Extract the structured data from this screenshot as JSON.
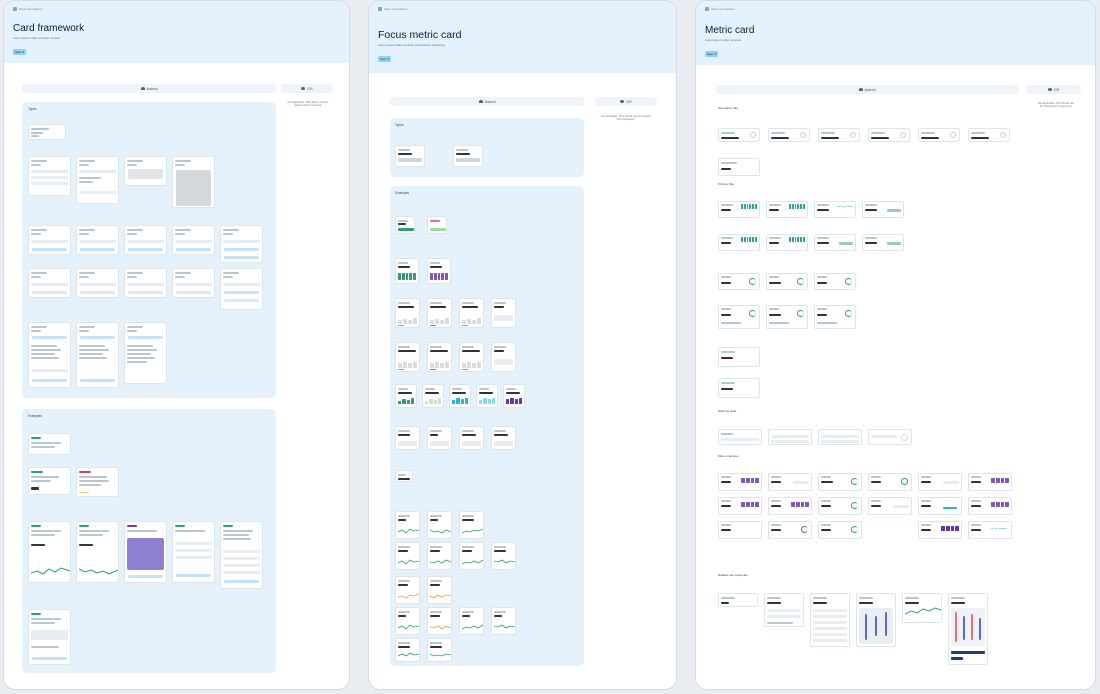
{
  "pages": [
    {
      "breadcrumb": "Wear Annotations",
      "title": "Card framework",
      "subtitle": "Lorem ipsum dolor sit amet consect",
      "spec_chip": "Spec ▾",
      "tabs": {
        "android": "Android",
        "ios": "iOS"
      },
      "note": "Not applicable. This doesn't use the nearest iOS component.",
      "sections": {
        "types": "Types",
        "examples": "Examples"
      }
    },
    {
      "breadcrumb": "Wear Annotations",
      "title": "Focus metric card",
      "subtitle": "Lorem ipsum dolor sit amet consectetur adipiscing",
      "spec_chip": "Spec ▾",
      "tabs": {
        "android": "Android",
        "ios": "iOS"
      },
      "note": "Not applicable. This should use the nearest iOS component.",
      "sections": {
        "types": "Types",
        "examples": "Examples"
      }
    },
    {
      "breadcrumb": "Wear Annotations",
      "title": "Metric card",
      "subtitle": "Lorem ipsum dolor sit amet",
      "spec_chip": "Spec ▾",
      "tabs": {
        "android": "Android",
        "ios": "iOS"
      },
      "note": "Not applicable. This should use the nearest iOS component.",
      "sections": {
        "secondary": "Secondary title",
        "primary": "Primary title",
        "warnings": "Warning state",
        "more": "More examples",
        "related": "Related use examples"
      }
    }
  ],
  "colors": {
    "header_bg": "#e3f2fd",
    "panel_bg": "#e6f2fb",
    "green": "#2e9f6e",
    "purple": "#6a3fb5",
    "cyan": "#27b7d6",
    "accent_chip": "#8fd3fb"
  }
}
